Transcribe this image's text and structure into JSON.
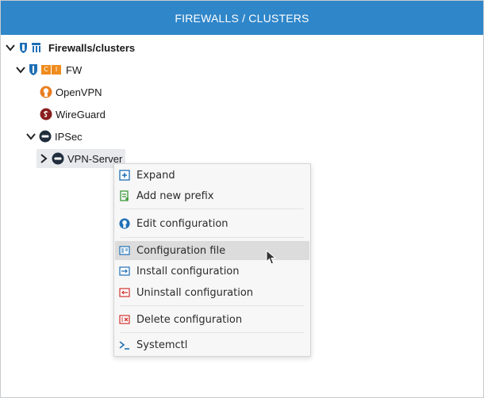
{
  "header": {
    "title": "FIREWALLS / CLUSTERS"
  },
  "tree": {
    "root": {
      "label": "Firewalls/clusters"
    },
    "fw": {
      "label": "FW",
      "badge_letters": [
        "C",
        "I"
      ]
    },
    "openvpn": {
      "label": "OpenVPN"
    },
    "wireguard": {
      "label": "WireGuard"
    },
    "ipsec": {
      "label": "IPSec"
    },
    "vpnserver": {
      "label": "VPN-Server"
    }
  },
  "context_menu": {
    "expand": "Expand",
    "add_prefix": "Add new prefix",
    "edit_config": "Edit configuration",
    "config_file": "Configuration file",
    "install_config": "Install configuration",
    "uninstall_config": "Uninstall configuration",
    "delete_config": "Delete configuration",
    "systemctl": "Systemctl"
  },
  "colors": {
    "header_bg": "#2f86c9",
    "shield_blue": "#1f6fb5",
    "badge_orange": "#f08c1e",
    "openvpn_orange": "#ea7e20",
    "wireguard_red": "#8a1e1e",
    "ipsec_dark": "#1f2d3d",
    "menu_red": "#d0312d"
  }
}
